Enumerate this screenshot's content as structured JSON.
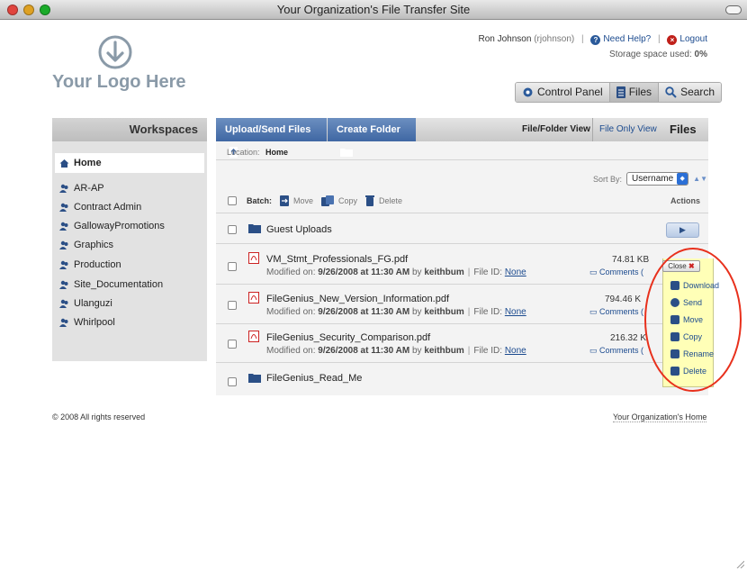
{
  "window": {
    "title": "Your Organization's File Transfer Site"
  },
  "logo": {
    "text": "Your Logo Here"
  },
  "user": {
    "name": "Ron Johnson",
    "username": "(rjohnson)",
    "help": "Need Help?",
    "logout": "Logout",
    "storage_label": "Storage space used:",
    "storage_value": "0%"
  },
  "tabs": [
    {
      "label": "Control Panel"
    },
    {
      "label": "Files"
    },
    {
      "label": "Search"
    }
  ],
  "sidebar": {
    "title": "Workspaces",
    "items": [
      {
        "label": "Home"
      },
      {
        "label": "AR-AP"
      },
      {
        "label": "Contract Admin"
      },
      {
        "label": "GallowayPromotions"
      },
      {
        "label": "Graphics"
      },
      {
        "label": "Production"
      },
      {
        "label": "Site_Documentation"
      },
      {
        "label": "Ulanguzi"
      },
      {
        "label": "Whirlpool"
      }
    ]
  },
  "toolbar": {
    "upload_label": "Upload/Send Files",
    "create_folder_label": "Create Folder",
    "view_label": "File/Folder View",
    "file_only_label": "File Only View",
    "section_title": "Files"
  },
  "location": {
    "label": "Location:",
    "value": "Home"
  },
  "sort": {
    "label": "Sort By:",
    "value": "Username"
  },
  "batch": {
    "label": "Batch:",
    "move": "Move",
    "copy": "Copy",
    "delete": "Delete",
    "actions": "Actions"
  },
  "rows": [
    {
      "name": "Guest Uploads"
    },
    {
      "name": "VM_Stmt_Professionals_FG.pdf",
      "meta_prefix": "Modified on:",
      "date": "9/26/2008 at 11:30 AM",
      "by": "by",
      "user": "keithbum",
      "fileid_label": "File ID:",
      "fileid": "None",
      "size": "74.81 KB",
      "comments": "Comments ("
    },
    {
      "name": "FileGenius_New_Version_Information.pdf",
      "meta_prefix": "Modified on:",
      "date": "9/26/2008 at 11:30 AM",
      "by": "by",
      "user": "keithbum",
      "fileid_label": "File ID:",
      "fileid": "None",
      "size": "794.46 K",
      "comments": "Comments ("
    },
    {
      "name": "FileGenius_Security_Comparison.pdf",
      "meta_prefix": "Modified on:",
      "date": "9/26/2008 at 11:30 AM",
      "by": "by",
      "user": "keithbum",
      "fileid_label": "File ID:",
      "fileid": "None",
      "size": "216.32 K",
      "comments": "Comments ("
    },
    {
      "name": "FileGenius_Read_Me"
    }
  ],
  "popup": {
    "close": "Close",
    "items": [
      {
        "label": "Download"
      },
      {
        "label": "Send"
      },
      {
        "label": "Move"
      },
      {
        "label": "Copy"
      },
      {
        "label": "Rename"
      },
      {
        "label": "Delete"
      }
    ]
  },
  "footer": {
    "copyright": "© 2008 All rights reserved",
    "home_link": "Your Organization's Home"
  },
  "colors": {
    "accent": "#3f67a3",
    "link": "#1c4b8f",
    "popup_bg": "#ffffb7",
    "highlight_ring": "#e8301c"
  }
}
